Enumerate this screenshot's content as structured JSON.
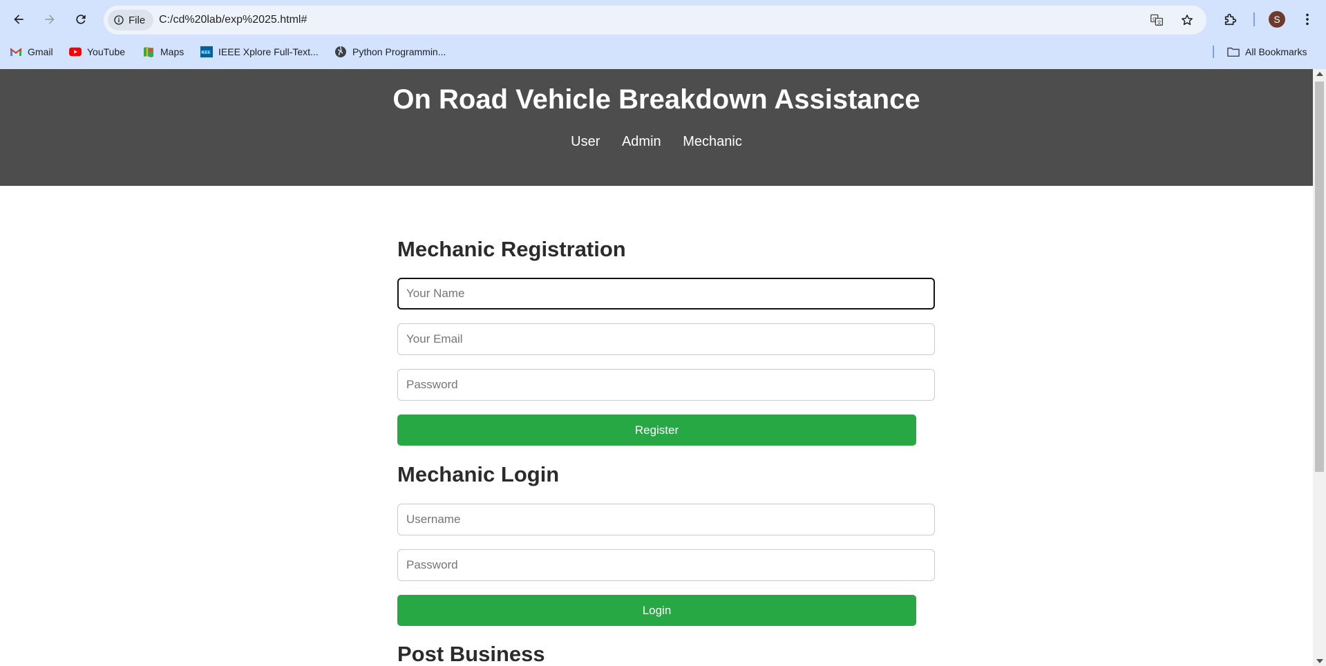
{
  "browser": {
    "url": "C:/cd%20lab/exp%2025.html#",
    "site_info_label": "File",
    "profile_initial": "S",
    "icons": {
      "back": "arrow-left-icon",
      "forward": "arrow-right-icon",
      "reload": "reload-icon",
      "info": "info-icon",
      "translate": "translate-icon",
      "bookmark_star": "star-icon",
      "extensions": "puzzle-icon",
      "menu": "kebab-menu-icon"
    },
    "bookmarks": [
      {
        "label": "Gmail",
        "icon": "gmail-icon"
      },
      {
        "label": "YouTube",
        "icon": "youtube-icon"
      },
      {
        "label": "Maps",
        "icon": "maps-icon"
      },
      {
        "label": "IEEE Xplore Full-Text...",
        "icon": "ieee-icon"
      },
      {
        "label": "Python Programmin...",
        "icon": "globe-icon"
      }
    ],
    "all_bookmarks_label": "All Bookmarks",
    "colors": {
      "chrome_bg": "#d3e3fd",
      "omnibox_bg": "#eef3fb"
    }
  },
  "site": {
    "title": "On Road Vehicle Breakdown Assistance",
    "nav": [
      "User",
      "Admin",
      "Mechanic"
    ],
    "colors": {
      "header_bg": "#4d4d4d",
      "button_bg": "#28a745"
    }
  },
  "registration": {
    "heading": "Mechanic Registration",
    "name_placeholder": "Your Name",
    "email_placeholder": "Your Email",
    "password_placeholder": "Password",
    "button_label": "Register"
  },
  "login": {
    "heading": "Mechanic Login",
    "username_placeholder": "Username",
    "password_placeholder": "Password",
    "button_label": "Login"
  },
  "post_business": {
    "heading": "Post Business"
  }
}
